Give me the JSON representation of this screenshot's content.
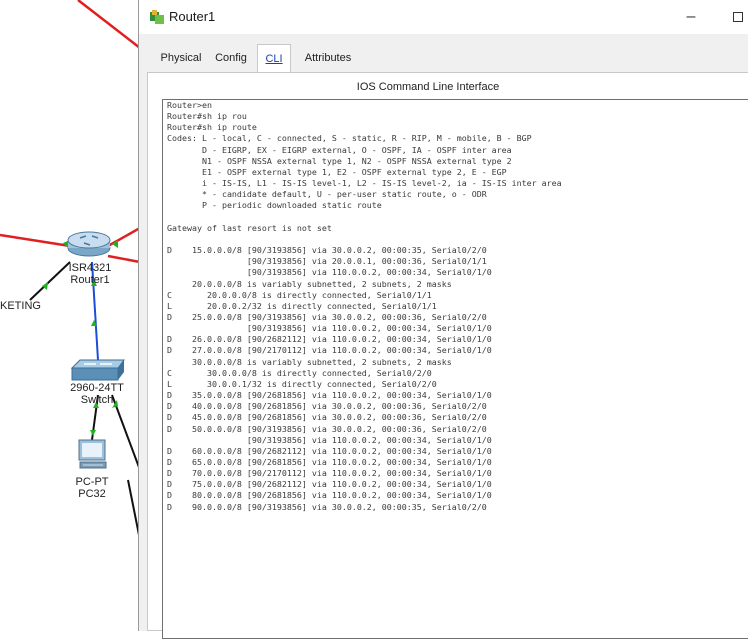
{
  "window": {
    "title": "Router1",
    "minimize_glyph": "–",
    "tabs": [
      {
        "label": "Physical",
        "active": false
      },
      {
        "label": "Config",
        "active": false
      },
      {
        "label": "CLI",
        "active": true
      },
      {
        "label": "Attributes",
        "active": false
      }
    ],
    "panel_title": "IOS Command Line Interface"
  },
  "topology": {
    "router_label": "ISR4321\nRouter1",
    "switch_label": "2960-24TT\nSwitch",
    "pc_label": "PC-PT\nPC32",
    "network_label": "KETING",
    "link_colors": {
      "red": "#e02020",
      "green": "#1db41d",
      "black": "#111111"
    }
  },
  "cli": {
    "lines": [
      "Router>en",
      "Router#sh ip rou",
      "Router#sh ip route",
      "Codes: L - local, C - connected, S - static, R - RIP, M - mobile, B - BGP",
      "       D - EIGRP, EX - EIGRP external, O - OSPF, IA - OSPF inter area",
      "       N1 - OSPF NSSA external type 1, N2 - OSPF NSSA external type 2",
      "       E1 - OSPF external type 1, E2 - OSPF external type 2, E - EGP",
      "       i - IS-IS, L1 - IS-IS level-1, L2 - IS-IS level-2, ia - IS-IS inter area",
      "       * - candidate default, U - per-user static route, o - ODR",
      "       P - periodic downloaded static route",
      "",
      "Gateway of last resort is not set",
      "",
      "D    15.0.0.0/8 [90/3193856] via 30.0.0.2, 00:00:35, Serial0/2/0",
      "                [90/3193856] via 20.0.0.1, 00:00:36, Serial0/1/1",
      "                [90/3193856] via 110.0.0.2, 00:00:34, Serial0/1/0",
      "     20.0.0.0/8 is variably subnetted, 2 subnets, 2 masks",
      "C       20.0.0.0/8 is directly connected, Serial0/1/1",
      "L       20.0.0.2/32 is directly connected, Serial0/1/1",
      "D    25.0.0.0/8 [90/3193856] via 30.0.0.2, 00:00:36, Serial0/2/0",
      "                [90/3193856] via 110.0.0.2, 00:00:34, Serial0/1/0",
      "D    26.0.0.0/8 [90/2682112] via 110.0.0.2, 00:00:34, Serial0/1/0",
      "D    27.0.0.0/8 [90/2170112] via 110.0.0.2, 00:00:34, Serial0/1/0",
      "     30.0.0.0/8 is variably subnetted, 2 subnets, 2 masks",
      "C       30.0.0.0/8 is directly connected, Serial0/2/0",
      "L       30.0.0.1/32 is directly connected, Serial0/2/0",
      "D    35.0.0.0/8 [90/2681856] via 110.0.0.2, 00:00:34, Serial0/1/0",
      "D    40.0.0.0/8 [90/2681856] via 30.0.0.2, 00:00:36, Serial0/2/0",
      "D    45.0.0.0/8 [90/2681856] via 30.0.0.2, 00:00:36, Serial0/2/0",
      "D    50.0.0.0/8 [90/3193856] via 30.0.0.2, 00:00:36, Serial0/2/0",
      "                [90/3193856] via 110.0.0.2, 00:00:34, Serial0/1/0",
      "D    60.0.0.0/8 [90/2682112] via 110.0.0.2, 00:00:34, Serial0/1/0",
      "D    65.0.0.0/8 [90/2681856] via 110.0.0.2, 00:00:34, Serial0/1/0",
      "D    70.0.0.0/8 [90/2170112] via 110.0.0.2, 00:00:34, Serial0/1/0",
      "D    75.0.0.0/8 [90/2682112] via 110.0.0.2, 00:00:34, Serial0/1/0",
      "D    80.0.0.0/8 [90/2681856] via 110.0.0.2, 00:00:34, Serial0/1/0",
      "D    90.0.0.0/8 [90/3193856] via 30.0.0.2, 00:00:35, Serial0/2/0"
    ]
  }
}
